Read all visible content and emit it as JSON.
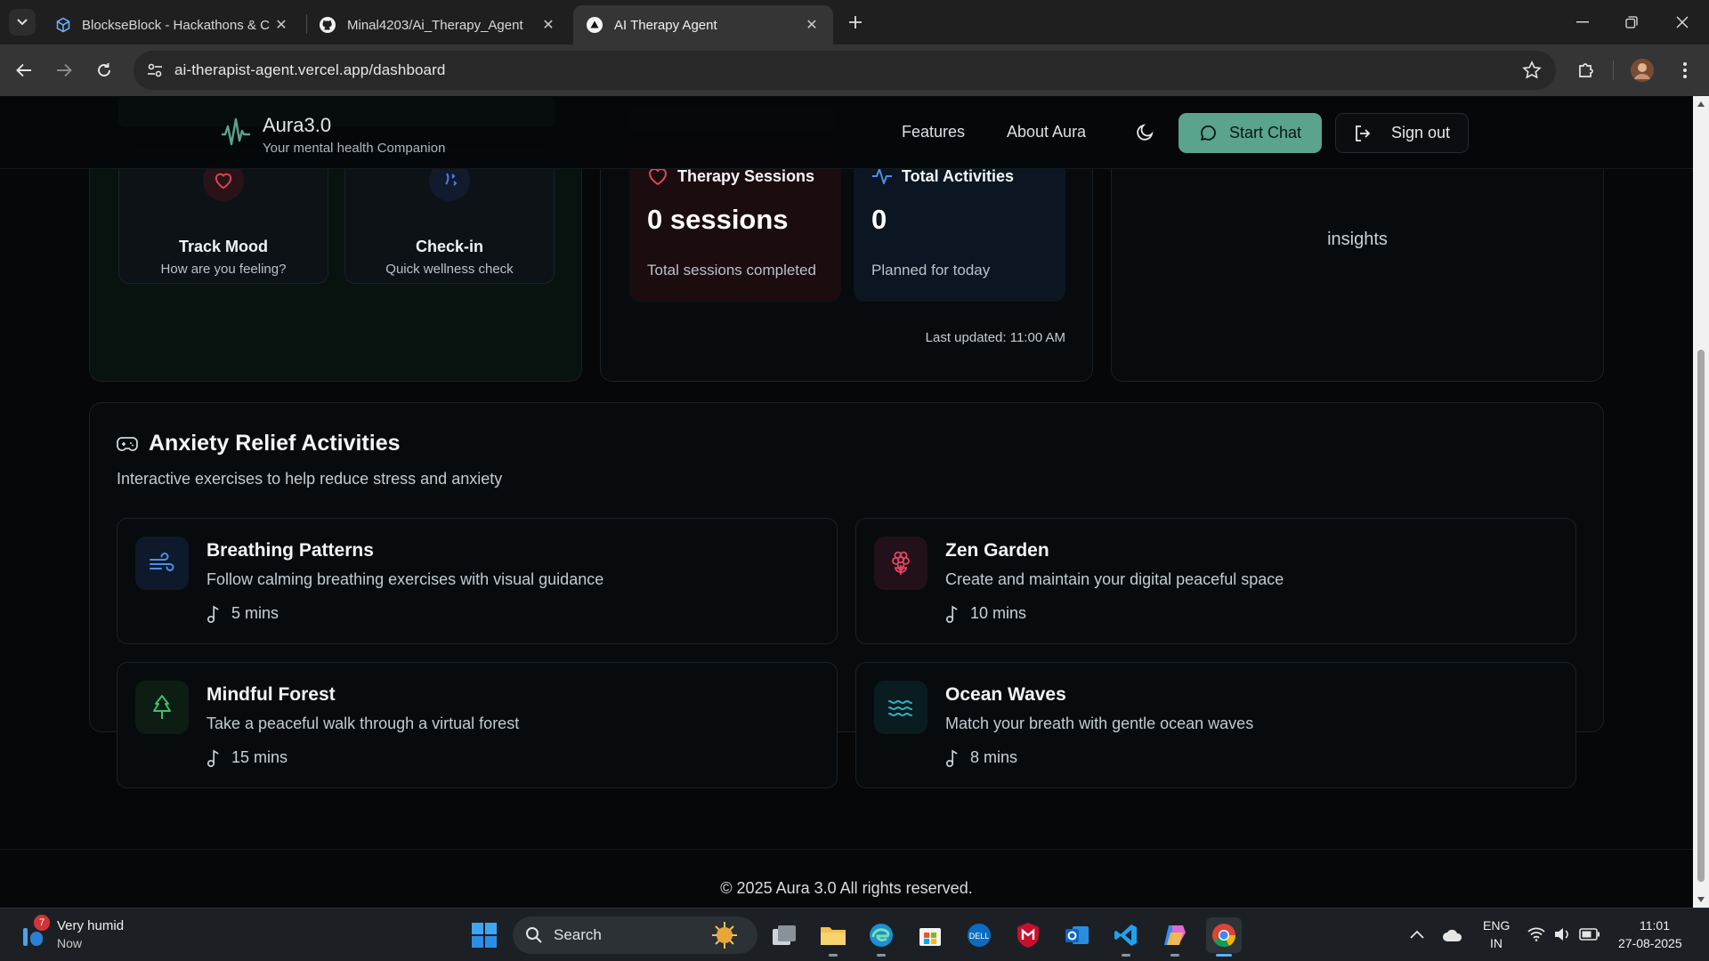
{
  "browser": {
    "tabs": [
      {
        "title": "BlockseBlock - Hackathons & C",
        "active": false
      },
      {
        "title": "Minal4203/Ai_Therapy_Agent",
        "active": false
      },
      {
        "title": "AI Therapy Agent",
        "active": true
      }
    ],
    "url": "ai-therapist-agent.vercel.app/dashboard"
  },
  "header": {
    "brand_name": "Aura3.0",
    "brand_tagline": "Your mental health Companion",
    "nav": [
      "Features",
      "About Aura"
    ],
    "start_chat": "Start Chat",
    "sign_out": "Sign out"
  },
  "quick_actions": [
    {
      "title": "Track Mood",
      "subtitle": "How are you feeling?",
      "icon": "heart-icon",
      "color": "#e0475f"
    },
    {
      "title": "Check-in",
      "subtitle": "Quick wellness check",
      "icon": "sparkle-icon",
      "color": "#4f7fe0"
    }
  ],
  "stats": [
    {
      "title": "Therapy Sessions",
      "value": "0 sessions",
      "subtitle": "Total sessions completed",
      "icon": "heart-icon",
      "color": "#e0475f"
    },
    {
      "title": "Total Activities",
      "value": "0",
      "subtitle": "Planned for today",
      "icon": "activity-icon",
      "color": "#4f8fe6"
    }
  ],
  "last_updated": "Last updated: 11:00 AM",
  "insights_text": "insights",
  "activities_section": {
    "title": "Anxiety Relief Activities",
    "subtitle": "Interactive exercises to help reduce stress and anxiety",
    "items": [
      {
        "name": "Breathing Patterns",
        "description": "Follow calming breathing exercises with visual guidance",
        "duration": "5 mins",
        "icon": "wind-icon",
        "color": "#4f8fe6"
      },
      {
        "name": "Zen Garden",
        "description": "Create and maintain your digital peaceful space",
        "duration": "10 mins",
        "icon": "flower-icon",
        "color": "#e0475f"
      },
      {
        "name": "Mindful Forest",
        "description": "Take a peaceful walk through a virtual forest",
        "duration": "15 mins",
        "icon": "tree-icon",
        "color": "#3fbf6a"
      },
      {
        "name": "Ocean Waves",
        "description": "Match your breath with gentle ocean waves",
        "duration": "8 mins",
        "icon": "waves-icon",
        "color": "#2fb5c9"
      }
    ]
  },
  "footer": "© 2025 Aura 3.0 All rights reserved.",
  "taskbar": {
    "weather_title": "Very humid",
    "weather_sub": "Now",
    "weather_badge": "7",
    "search_label": "Search",
    "lang_line1": "ENG",
    "lang_line2": "IN",
    "time": "11:01",
    "date": "27-08-2025"
  }
}
